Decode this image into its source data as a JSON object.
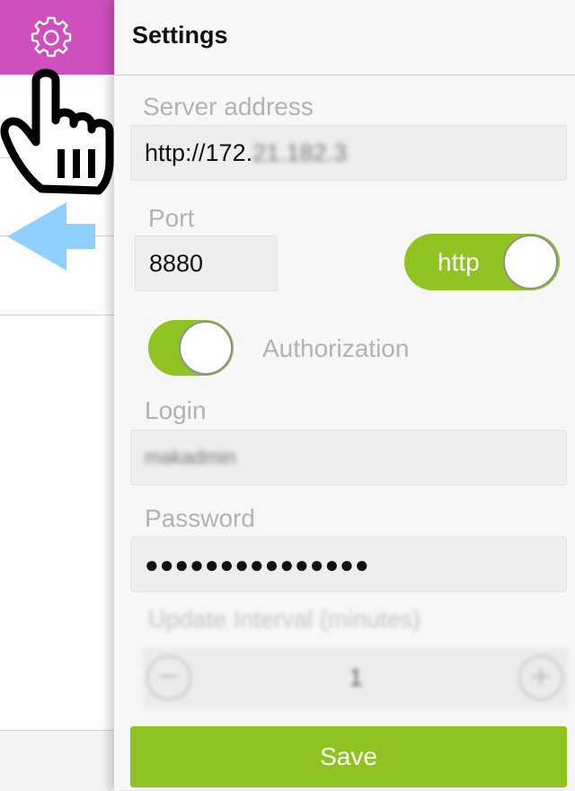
{
  "header": {
    "title": "Settings"
  },
  "server": {
    "label": "Server address",
    "value_visible": "http://172.",
    "value_blurred": "21.182.3"
  },
  "port": {
    "label": "Port",
    "value": "8880"
  },
  "protocol_toggle": {
    "label": "http",
    "on": true
  },
  "authorization": {
    "label": "Authorization",
    "on": true
  },
  "login": {
    "label": "Login",
    "value": "makadmin"
  },
  "password": {
    "label": "Password",
    "value": "●●●●●●●●●●●●●●●"
  },
  "update_interval": {
    "label": "Update Interval (minutes)",
    "value": "1",
    "minus_icon": "minus-icon",
    "plus_icon": "plus-icon"
  },
  "save": {
    "label": "Save"
  },
  "colors": {
    "accent_green": "#8fc322",
    "gear_tab_magenta": "#cf4fbd",
    "arrow_blue": "#8fd0ff"
  },
  "icons": {
    "gear": "gear-icon",
    "back": "back-arrow-icon",
    "pointer": "pointing-hand-icon"
  }
}
